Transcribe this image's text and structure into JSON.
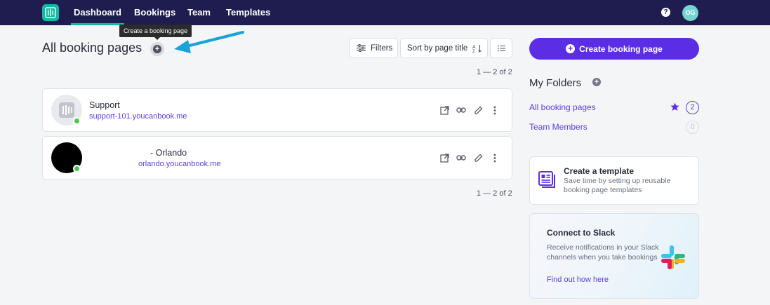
{
  "nav": {
    "tabs": [
      {
        "label": "Dashboard",
        "active": true
      },
      {
        "label": "Bookings"
      },
      {
        "label": "Team"
      },
      {
        "label": "Templates"
      }
    ],
    "help_label": "?",
    "avatar_initials": "OG"
  },
  "tooltip": "Create a booking page",
  "header": {
    "title": "All booking pages",
    "filters_label": "Filters",
    "sort_label": "Sort by page title"
  },
  "pagination": {
    "top": "1 — 2 of 2",
    "bottom": "1 — 2 of 2"
  },
  "cards": [
    {
      "title": "Support",
      "url": "support-101.youcanbook.me",
      "status": "online"
    },
    {
      "title": "- Orlando",
      "url": "orlando.youcanbook.me",
      "status": "online"
    }
  ],
  "sidebar": {
    "create_button": "Create booking page",
    "folders_title": "My Folders",
    "folders": [
      {
        "label": "All booking pages",
        "count": "2",
        "starred": true
      },
      {
        "label": "Team Members",
        "count": "0"
      }
    ],
    "template_card": {
      "title": "Create a template",
      "description": "Save time by setting up reusable booking page templates"
    },
    "slack_card": {
      "title": "Connect to Slack",
      "description": "Receive notifications in your Slack channels when you take bookings",
      "link": "Find out how here"
    }
  },
  "colors": {
    "nav_bg": "#1f1d4f",
    "accent": "#5b2ee6",
    "link": "#5c3ee0",
    "brand_teal": "#16b8a3",
    "status_green": "#4cc253",
    "annotation_arrow": "#1aa3d6"
  }
}
